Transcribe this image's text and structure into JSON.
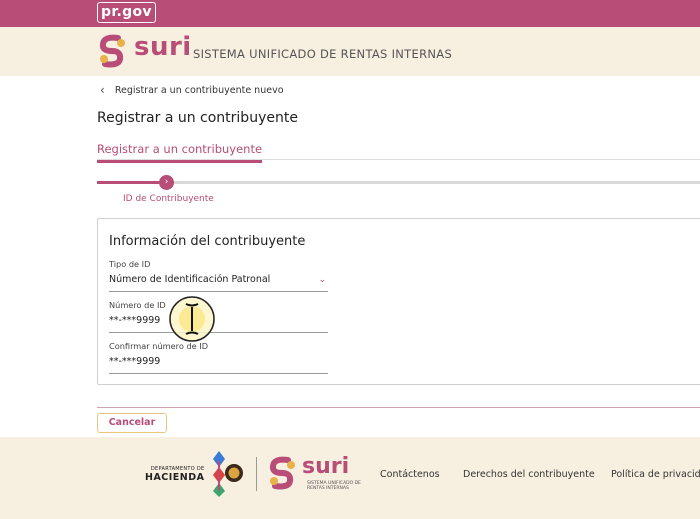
{
  "topbar": {
    "brand": "pr.gov"
  },
  "header": {
    "logo_word": "suri",
    "subtitle": "SISTEMA UNIFICADO DE RENTAS INTERNAS"
  },
  "breadcrumb": {
    "back_label": "Registrar a un contribuyente nuevo"
  },
  "page": {
    "title": "Registrar a un contribuyente",
    "tab": "Registrar a un contribuyente"
  },
  "stepper": {
    "current_step_label": "ID de Contribuyente",
    "current_step_number": "1"
  },
  "form": {
    "card_title": "Información del contribuyente",
    "tipo_id_label": "Tipo de ID",
    "tipo_id_value": "Número de Identificación Patronal",
    "numero_id_label": "Número de ID",
    "numero_id_value": "**-***9999",
    "confirmar_label": "Confirmar número de ID",
    "confirmar_value": "**-***9999"
  },
  "actions": {
    "cancel_label": "Cancelar"
  },
  "footer": {
    "hacienda_small": "DEPARTAMENTO DE",
    "hacienda_big": "HACIENDA",
    "suri_word": "suri",
    "suri_sub": "SISTEMA UNIFICADO DE RENTAS INTERNAS",
    "links": [
      "Contáctenos",
      "Derechos del contribuyente",
      "Política de privacidad"
    ]
  },
  "colors": {
    "brand": "#b84d78",
    "cream": "#f7efe0",
    "gold": "#e6c77d"
  }
}
